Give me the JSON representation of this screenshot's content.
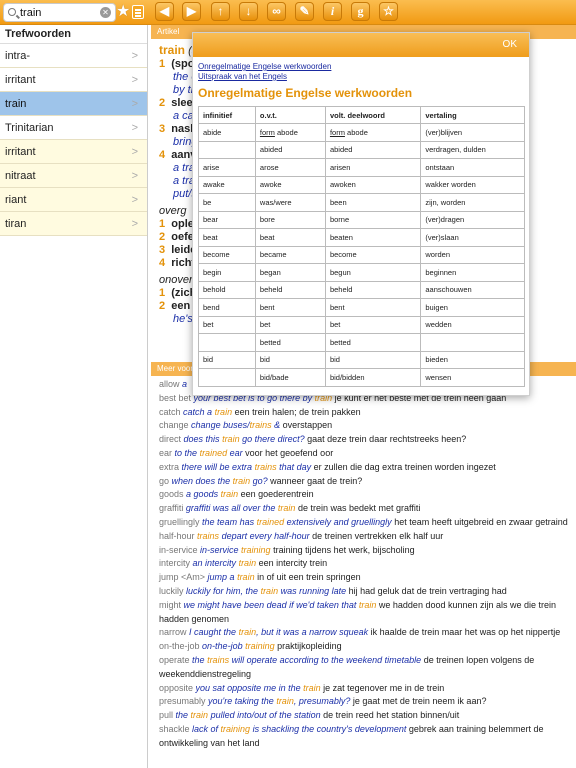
{
  "toolbar": {
    "search_value": "train",
    "clear_glyph": "✕",
    "star_glyph": "★",
    "btn_back": "◀",
    "btn_forward": "▶",
    "btn_up": "↑",
    "btn_down": "↓",
    "btn_link": "∞",
    "btn_edit": "✎",
    "btn_info": "i",
    "btn_grammar": "g",
    "btn_fav": "☆"
  },
  "sidebar": {
    "title": "Trefwoorden",
    "items": [
      {
        "label": "intra-"
      },
      {
        "label": "irritant"
      },
      {
        "label": "train"
      },
      {
        "label": "Trinitarian"
      },
      {
        "label": "irritant"
      },
      {
        "label": "nitraat"
      },
      {
        "label": "riant"
      },
      {
        "label": "tiran"
      }
    ]
  },
  "main": {
    "section_label": "Artikel",
    "meer_label": "Meer voorbeelden"
  },
  "article": {
    "hw": "train",
    "hw_rest": "(s",
    "s1n": "1",
    "s1b": "(spo",
    "s1l2": "the c",
    "s1l3": "by tr",
    "s2n": "2",
    "s2b": "slee",
    "s2l2": "a car",
    "s3n": "3",
    "s3b": "nasl",
    "s3l2": "bring",
    "s4n": "4",
    "s4b": "aanv",
    "s4l2": "a tra",
    "s4l3": "a tra",
    "s4l4": "put/s",
    "overg": "overg",
    "o1n": "1",
    "o1b": "ople",
    "o2n": "2",
    "o2b": "oefe",
    "o3n": "3",
    "o3b": "leide",
    "o4n": "4",
    "o4b": "richt",
    "onover": "onover",
    "on1n": "1",
    "on1b": "(zich",
    "on2n": "2",
    "on2b": "een",
    "on2l2": "he's"
  },
  "examples": [
    {
      "k": "allow",
      "e": "a"
    },
    {
      "k": "best bet",
      "e": "your best bet is to go there by train",
      "nl": "je kunt er het beste met de trein heen gaan"
    },
    {
      "k": "catch",
      "e": "catch a train",
      "nl": "een trein halen; de trein pakken"
    },
    {
      "k": "change",
      "e": "change buses/trains &",
      "nl": "overstappen"
    },
    {
      "k": "direct",
      "e": "does this train go there direct?",
      "nl": "gaat deze trein daar rechtstreeks heen?"
    },
    {
      "k": "ear",
      "e": "to the trained ear",
      "nl": "voor het geoefend oor"
    },
    {
      "k": "extra",
      "e": "there will be extra trains that day",
      "nl": "er zullen die dag extra treinen worden ingezet"
    },
    {
      "k": "go",
      "e": "when does the train go?",
      "nl": "wanneer gaat de trein?"
    },
    {
      "k": "goods",
      "e": "a goods train",
      "nl": "een goederentrein"
    },
    {
      "k": "graffiti",
      "e": "graffiti was all over the train",
      "nl": "de trein was bedekt met graffiti"
    },
    {
      "k": "gruellingly",
      "e": "the team has trained extensively and gruellingly",
      "nl": "het team heeft uitgebreid en zwaar getraind"
    },
    {
      "k": "half-hour",
      "e": "trains depart every half-hour",
      "nl": "de treinen vertrekken elk half uur"
    },
    {
      "k": "in-service",
      "e": "in-service training",
      "nl": "training tijdens het werk, bijscholing"
    },
    {
      "k": "intercity",
      "e": "an intercity train",
      "nl": "een intercity trein"
    },
    {
      "k": "jump <Am>",
      "e": "jump a train",
      "nl": "in of uit een trein springen"
    },
    {
      "k": "luckily",
      "e": "luckily for him, the train was running late",
      "nl": "hij had geluk dat de trein vertraging had"
    },
    {
      "k": "might",
      "e": "we might have been dead if we'd taken that train",
      "nl": "we hadden dood kunnen zijn als we die trein hadden genomen"
    },
    {
      "k": "narrow",
      "e": "I caught the train, but it was a narrow squeak",
      "nl": "ik haalde de trein maar het was op het nippertje"
    },
    {
      "k": "on-the-job",
      "e": "on-the-job training",
      "nl": "praktijkopleiding"
    },
    {
      "k": "operate",
      "e": "the trains will operate according to the weekend timetable",
      "nl": "de treinen lopen volgens de weekenddienstregeling"
    },
    {
      "k": "opposite",
      "e": "you sat opposite me in the train",
      "nl": "je zat tegenover me in de trein"
    },
    {
      "k": "presumably",
      "e": "you're taking the train, presumably?",
      "nl": "je gaat met de trein neem ik aan?"
    },
    {
      "k": "pull",
      "e": "the train pulled into/out of the station",
      "nl": "de trein reed het station binnen/uit"
    },
    {
      "k": "shackle",
      "e": "lack of training is shackling the country's development",
      "nl": "gebrek aan training belemmert de ontwikkeling van het land"
    }
  ],
  "popup": {
    "ok": "OK",
    "link1": "Onregelmatige Engelse werkwoorden",
    "link2": "Uitspraak van het Engels",
    "title": "Onregelmatige Engelse werkwoorden",
    "headers": [
      "infinitief",
      "o.v.t.",
      "volt. deelwoord",
      "vertaling"
    ],
    "rows": [
      [
        "abide",
        "form abode",
        "form abode",
        "(ver)blijven"
      ],
      [
        "",
        "abided",
        "abided",
        "verdragen, dulden"
      ],
      [
        "arise",
        "arose",
        "arisen",
        "ontstaan"
      ],
      [
        "awake",
        "awoke",
        "awoken",
        "wakker worden"
      ],
      [
        "be",
        "was/were",
        "been",
        "zijn, worden"
      ],
      [
        "bear",
        "bore",
        "borne",
        "(ver)dragen"
      ],
      [
        "beat",
        "beat",
        "beaten",
        "(ver)slaan"
      ],
      [
        "become",
        "became",
        "become",
        "worden"
      ],
      [
        "begin",
        "began",
        "begun",
        "beginnen"
      ],
      [
        "behold",
        "beheld",
        "beheld",
        "aanschouwen"
      ],
      [
        "bend",
        "bent",
        "bent",
        "buigen"
      ],
      [
        "bet",
        "bet",
        "bet",
        "wedden"
      ],
      [
        "",
        "betted",
        "betted",
        ""
      ],
      [
        "bid",
        "bid",
        "bid",
        "bieden"
      ],
      [
        "",
        "bid/bade",
        "bid/bidden",
        "wensen"
      ]
    ]
  },
  "colors": {
    "accent": "#f19a12",
    "link": "#1b2fa8",
    "selected": "#9ec4ea",
    "keyword": "#e3920a"
  }
}
